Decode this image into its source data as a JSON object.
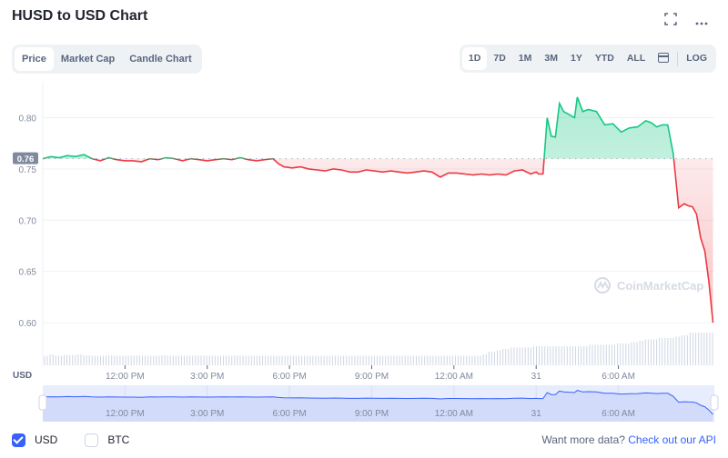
{
  "header": {
    "title": "HUSD to USD Chart",
    "fullscreen_icon": "fullscreen-icon",
    "more_icon": "more-horizontal-icon"
  },
  "tabs": [
    {
      "label": "Price",
      "active": true
    },
    {
      "label": "Market Cap",
      "active": false
    },
    {
      "label": "Candle Chart",
      "active": false
    }
  ],
  "ranges": [
    {
      "label": "1D",
      "active": true
    },
    {
      "label": "7D",
      "active": false
    },
    {
      "label": "1M",
      "active": false
    },
    {
      "label": "3M",
      "active": false
    },
    {
      "label": "1Y",
      "active": false
    },
    {
      "label": "YTD",
      "active": false
    },
    {
      "label": "ALL",
      "active": false
    }
  ],
  "calendar_icon": "calendar-icon",
  "log_label": "LOG",
  "watermark": "CoinMarketCap",
  "currency_axis_label": "USD",
  "colors": {
    "up": "#16c784",
    "down": "#ea3943",
    "navigator": "#3861fb",
    "link": "#3861fb"
  },
  "chart_data": {
    "type": "line",
    "title": "HUSD to USD Chart",
    "xlabel": "",
    "ylabel": "USD",
    "ylim": [
      0.585,
      0.835
    ],
    "yticks": [
      0.6,
      0.65,
      0.7,
      0.75,
      0.8
    ],
    "ytick_labels": [
      "0.60",
      "0.65",
      "0.70",
      "0.75",
      "0.80"
    ],
    "xtick_labels": [
      "12:00 PM",
      "3:00 PM",
      "6:00 PM",
      "9:00 PM",
      "12:00 AM",
      "31",
      "6:00 AM"
    ],
    "xtick_hours": [
      3,
      6,
      9,
      12,
      15,
      18,
      21
    ],
    "x_range_hours": [
      0,
      24.5
    ],
    "baseline": 0.76,
    "baseline_label": "0.76",
    "grid": true,
    "legend": "bottom-left",
    "x_hours": [
      0,
      0.3,
      0.6,
      0.9,
      1.2,
      1.5,
      1.8,
      2.1,
      2.4,
      2.7,
      3.0,
      3.3,
      3.6,
      3.9,
      4.2,
      4.5,
      4.8,
      5.1,
      5.4,
      5.7,
      6.0,
      6.3,
      6.6,
      6.9,
      7.2,
      7.5,
      7.8,
      8.1,
      8.4,
      8.6,
      8.8,
      9.1,
      9.4,
      9.7,
      10.0,
      10.3,
      10.6,
      10.9,
      11.2,
      11.5,
      11.8,
      12.1,
      12.4,
      12.7,
      13.0,
      13.3,
      13.6,
      13.9,
      14.2,
      14.5,
      14.8,
      15.1,
      15.4,
      15.7,
      16.0,
      16.3,
      16.6,
      16.9,
      17.2,
      17.5,
      17.8,
      18.0,
      18.1,
      18.25,
      18.4,
      18.55,
      18.7,
      18.85,
      19.0,
      19.2,
      19.4,
      19.5,
      19.7,
      19.9,
      20.2,
      20.5,
      20.8,
      21.1,
      21.4,
      21.7,
      22.0,
      22.2,
      22.4,
      22.6,
      22.8,
      23.0,
      23.2,
      23.4,
      23.55,
      23.7,
      23.85,
      24.0,
      24.15,
      24.3,
      24.45
    ],
    "values": [
      0.76,
      0.762,
      0.761,
      0.763,
      0.762,
      0.764,
      0.76,
      0.758,
      0.761,
      0.759,
      0.758,
      0.758,
      0.757,
      0.76,
      0.759,
      0.761,
      0.76,
      0.758,
      0.76,
      0.759,
      0.758,
      0.759,
      0.76,
      0.759,
      0.761,
      0.759,
      0.758,
      0.759,
      0.76,
      0.755,
      0.752,
      0.751,
      0.752,
      0.75,
      0.749,
      0.748,
      0.75,
      0.749,
      0.747,
      0.747,
      0.749,
      0.748,
      0.747,
      0.748,
      0.747,
      0.746,
      0.747,
      0.748,
      0.747,
      0.742,
      0.746,
      0.746,
      0.745,
      0.744,
      0.745,
      0.744,
      0.745,
      0.744,
      0.748,
      0.749,
      0.745,
      0.747,
      0.745,
      0.745,
      0.8,
      0.782,
      0.781,
      0.814,
      0.806,
      0.803,
      0.8,
      0.82,
      0.806,
      0.808,
      0.806,
      0.793,
      0.794,
      0.786,
      0.79,
      0.791,
      0.797,
      0.795,
      0.791,
      0.793,
      0.793,
      0.765,
      0.712,
      0.716,
      0.714,
      0.713,
      0.706,
      0.683,
      0.67,
      0.64,
      0.6
    ],
    "volume_relative": [
      0.15,
      0.2,
      0.15,
      0.18,
      0.18,
      0.2,
      0.17,
      0.15,
      0.15,
      0.16,
      0.15,
      0.15,
      0.15,
      0.16,
      0.15,
      0.15,
      0.15,
      0.16,
      0.15,
      0.15,
      0.15,
      0.15,
      0.16,
      0.15,
      0.15,
      0.15,
      0.15,
      0.16,
      0.15,
      0.15,
      0.15,
      0.15,
      0.15,
      0.15,
      0.15,
      0.15,
      0.15,
      0.15,
      0.15,
      0.15,
      0.15,
      0.15,
      0.15,
      0.15,
      0.15,
      0.15,
      0.15,
      0.15,
      0.15,
      0.15,
      0.15,
      0.15,
      0.15,
      0.15,
      0.15,
      0.15,
      0.15,
      0.15,
      0.15,
      0.15,
      0.15,
      0.15,
      0.2,
      0.3,
      0.35,
      0.4,
      0.45,
      0.45,
      0.45,
      0.5,
      0.5,
      0.5,
      0.5,
      0.5,
      0.5,
      0.5,
      0.5,
      0.55,
      0.55,
      0.55,
      0.55,
      0.6,
      0.6,
      0.65,
      0.7,
      0.75,
      0.75,
      0.8,
      0.8,
      0.85,
      0.9,
      1.0,
      1.0,
      1.0,
      1.0
    ]
  },
  "navigator": {
    "xtick_labels": [
      "12:00 PM",
      "3:00 PM",
      "6:00 PM",
      "9:00 PM",
      "12:00 AM",
      "31",
      "6:00 AM"
    ]
  },
  "footer": {
    "usd_label": "USD",
    "usd_checked": true,
    "btc_label": "BTC",
    "btc_checked": false,
    "api_prefix": "Want more data?",
    "api_link": "Check out our API"
  }
}
